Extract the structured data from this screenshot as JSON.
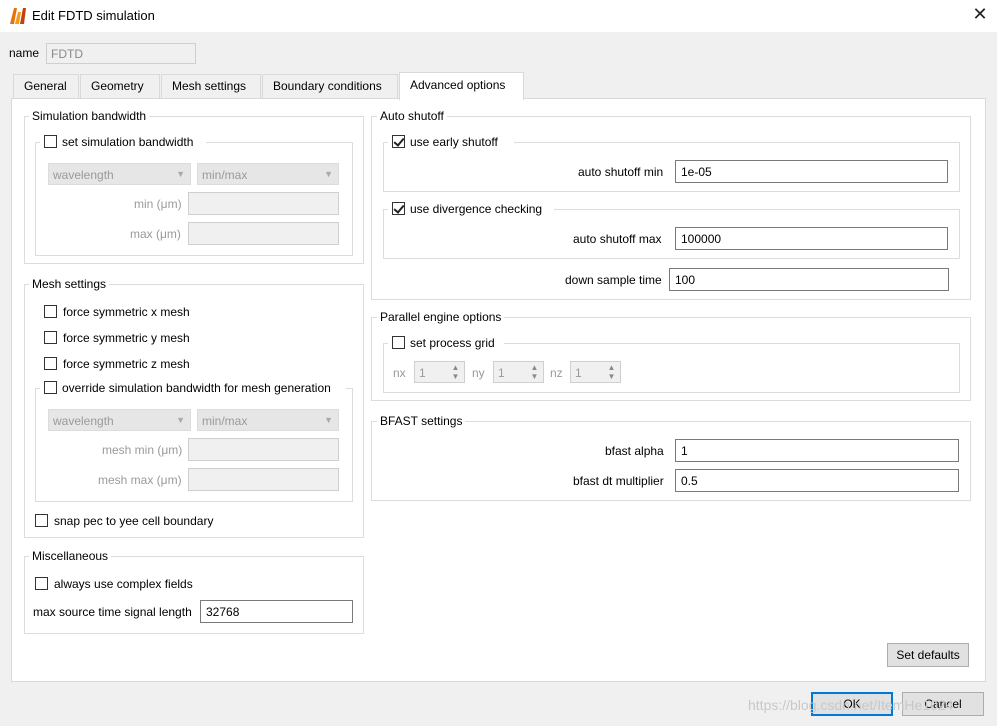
{
  "window": {
    "title": "Edit FDTD simulation",
    "close_icon": "close-icon"
  },
  "name_field": {
    "label": "name",
    "value": "FDTD"
  },
  "tabs": [
    {
      "label": "General"
    },
    {
      "label": "Geometry"
    },
    {
      "label": "Mesh settings"
    },
    {
      "label": "Boundary conditions"
    },
    {
      "label": "Advanced options"
    }
  ],
  "active_tab": "Advanced options",
  "simulation_bandwidth": {
    "title": "Simulation bandwidth",
    "set_label": "set simulation bandwidth",
    "set_checked": false,
    "type_select": "wavelength",
    "range_select": "min/max",
    "min_label": "min (μm)",
    "max_label": "max (μm)"
  },
  "mesh_settings": {
    "title": "Mesh settings",
    "force_x": "force symmetric x mesh",
    "force_y": "force symmetric y mesh",
    "force_z": "force symmetric z mesh",
    "override_label": "override simulation bandwidth for mesh generation",
    "type_select": "wavelength",
    "range_select": "min/max",
    "mesh_min_label": "mesh min (μm)",
    "mesh_max_label": "mesh max (μm)",
    "snap_label": "snap pec to yee cell boundary"
  },
  "misc": {
    "title": "Miscellaneous",
    "complex_label": "always use complex fields",
    "max_source_label": "max source time signal length",
    "max_source_value": "32768"
  },
  "auto_shutoff": {
    "title": "Auto shutoff",
    "early_label": "use early shutoff",
    "early_checked": true,
    "min_label": "auto shutoff min",
    "min_value": "1e-05",
    "divergence_label": "use divergence checking",
    "divergence_checked": true,
    "max_label": "auto shutoff max",
    "max_value": "100000",
    "down_sample_label": "down sample time",
    "down_sample_value": "100"
  },
  "parallel": {
    "title": "Parallel engine options",
    "grid_label": "set process grid",
    "nx_label": "nx",
    "nx_value": "1",
    "ny_label": "ny",
    "ny_value": "1",
    "nz_label": "nz",
    "nz_value": "1"
  },
  "bfast": {
    "title": "BFAST settings",
    "alpha_label": "bfast alpha",
    "alpha_value": "1",
    "dt_label": "bfast dt multiplier",
    "dt_value": "0.5"
  },
  "buttons": {
    "set_defaults": "Set defaults",
    "ok": "OK",
    "cancel": "Cancel"
  },
  "watermark": "https://blog.csdn.net/ItemHe1024"
}
